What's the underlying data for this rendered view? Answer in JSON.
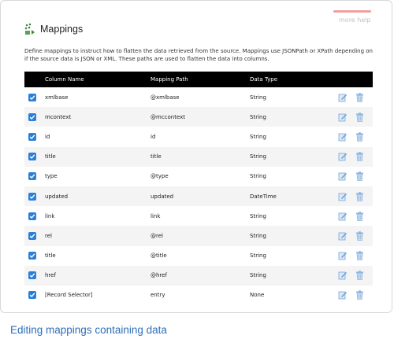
{
  "panel": {
    "more_help": "more help",
    "title": "Mappings",
    "description": "Define mappings to instruct how to flatten the data retrieved from the source. Mappings use JSONPath or XPath depending on if the source data is JSON or XML. These paths are used to flatten the data into columns."
  },
  "table": {
    "headers": [
      "Column Name",
      "Mapping Path",
      "Data Type"
    ],
    "rows": [
      {
        "column": "xmlbase",
        "path": "@xmlbase",
        "type": "String",
        "checked": true
      },
      {
        "column": "mcontext",
        "path": "@mccontext",
        "type": "String",
        "checked": true
      },
      {
        "column": "id",
        "path": "id",
        "type": "String",
        "checked": true
      },
      {
        "column": "title",
        "path": "title",
        "type": "String",
        "checked": true
      },
      {
        "column": "type",
        "path": "@type",
        "type": "String",
        "checked": true
      },
      {
        "column": "updated",
        "path": "updated",
        "type": "DateTime",
        "checked": true
      },
      {
        "column": "link",
        "path": "link",
        "type": "String",
        "checked": true
      },
      {
        "column": "rel",
        "path": "@rel",
        "type": "String",
        "checked": true
      },
      {
        "column": "title",
        "path": "@title",
        "type": "String",
        "checked": true
      },
      {
        "column": "href",
        "path": "@href",
        "type": "String",
        "checked": true
      },
      {
        "column": "[Record Selector]",
        "path": "entry",
        "type": "None",
        "checked": true
      }
    ]
  },
  "caption": "Editing mappings containing data",
  "colors": {
    "header_bg": "#000000",
    "checkbox": "#2b7fd8",
    "caption": "#2f6fb7",
    "alt_row": "#f4f4f4"
  },
  "icons": {
    "title": "mappings-icon",
    "edit": "edit-icon",
    "delete": "trash-icon"
  }
}
